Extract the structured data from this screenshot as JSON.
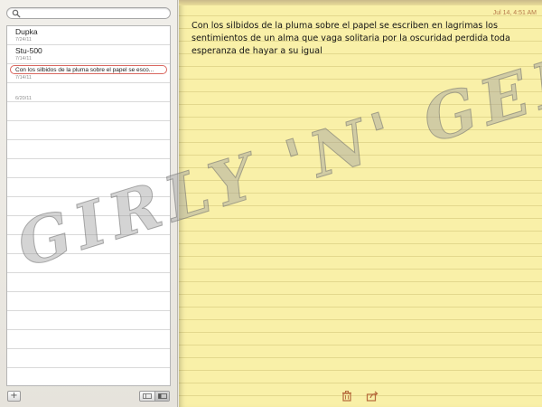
{
  "search": {
    "placeholder": "",
    "value": ""
  },
  "notes": [
    {
      "title": "Dupka",
      "date": "7/24/11",
      "selected": false
    },
    {
      "title": "Stu-500",
      "date": "7/14/11",
      "selected": false
    },
    {
      "title": "Con los silbidos de la pluma sobre el papel se esco...",
      "date": "7/14/11",
      "selected": true
    },
    {
      "title": "",
      "date": "6/20/11",
      "selected": false
    }
  ],
  "sidebar_footer": {
    "add_label": "+"
  },
  "note": {
    "timestamp": "Jul 14, 4:51 AM",
    "body": "Con los silbidos de la pluma sobre el papel se escriben en lagrimas los sentimientos de un alma que vaga solitaria por la oscuridad perdida toda esperanza de hayar a su igual"
  },
  "icons": {
    "search": "search-icon",
    "add": "plus-icon",
    "list_view": "list-view-icon",
    "split_view": "split-view-icon",
    "trash": "trash-icon",
    "share": "share-icon"
  },
  "watermark": "GIRLY 'N' GEEK",
  "colors": {
    "paper": "#f9f0a8",
    "timestamp": "#b67a4b",
    "icon_accent": "#b66a3c",
    "selection": "#d9675f"
  }
}
